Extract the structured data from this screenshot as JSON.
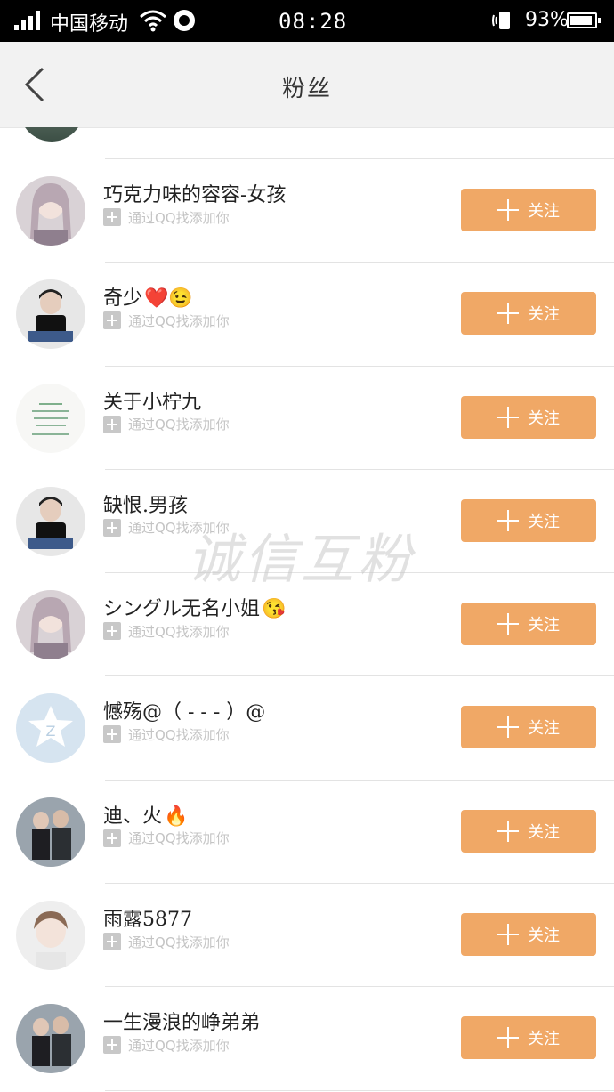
{
  "status_bar": {
    "carrier": "中国移动",
    "time": "08:28",
    "battery": "93%"
  },
  "header": {
    "title": "粉丝"
  },
  "follow_label": "关注",
  "sub_text": "通过QQ找添加你",
  "watermark": "诚信互粉",
  "fans": [
    {
      "name": "巧克力味的容容-女孩",
      "emoji": "",
      "avatar": "girl-avatar"
    },
    {
      "name": "奇少",
      "emoji": "❤️😉",
      "avatar": "boy-avatar"
    },
    {
      "name": "关于小柠九",
      "emoji": "",
      "avatar": "text-avatar"
    },
    {
      "name": "缺恨.男孩",
      "emoji": "",
      "avatar": "boy-avatar"
    },
    {
      "name": "シングル无名小姐",
      "emoji": "😘",
      "avatar": "girl-avatar"
    },
    {
      "name": "憾殇@（ - - - ）@",
      "emoji": "",
      "avatar": "default-qq-avatar"
    },
    {
      "name": "迪、火",
      "emoji": "🔥",
      "avatar": "couple-avatar"
    },
    {
      "name": "雨露5877",
      "emoji": "",
      "avatar": "child-avatar"
    },
    {
      "name": "一生漫浪的峥弟弟",
      "emoji": "",
      "avatar": "couple-avatar"
    }
  ]
}
